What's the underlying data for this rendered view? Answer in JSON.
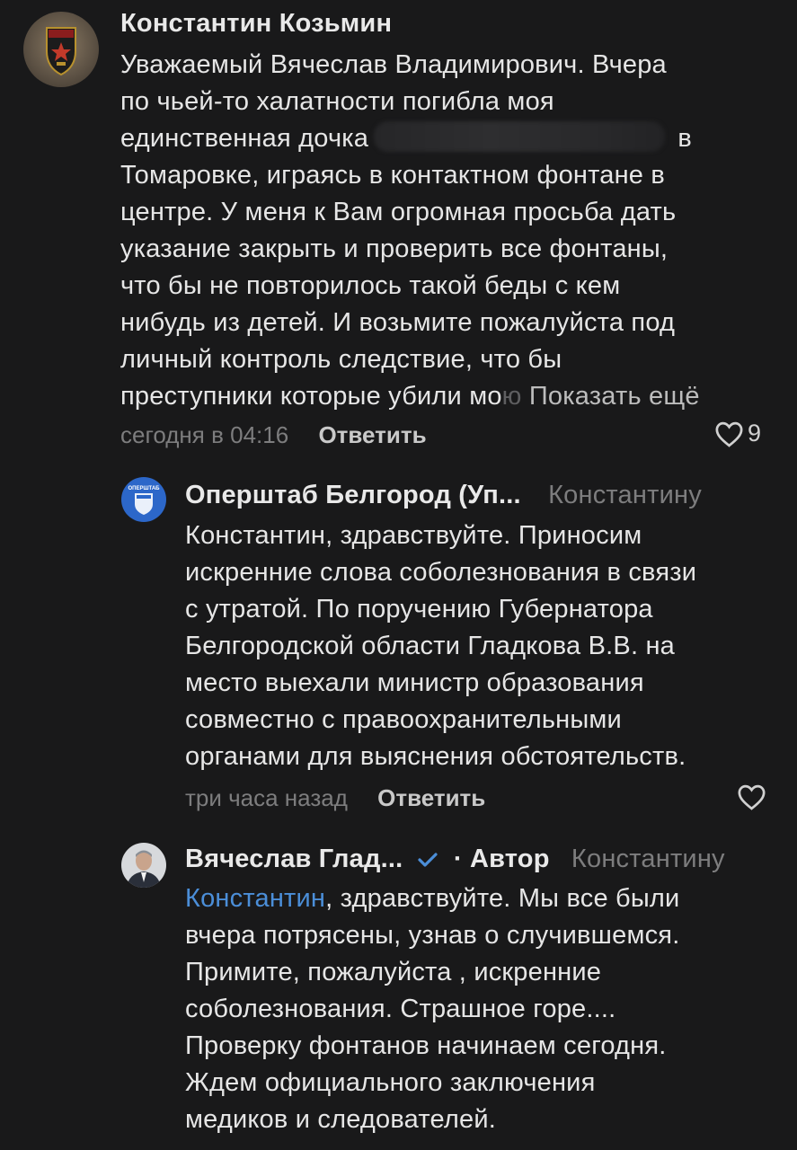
{
  "comments": [
    {
      "author": "Константин Козьмин",
      "text_lines": [
        "Уважаемый Вячеслав Владимирович. Вчера",
        "по чьей-то халатности погибла моя",
        "единственная дочка",
        "в",
        "Томаровке, играясь в контактном фонтане в",
        "центре. У меня к Вам огромная просьба дать",
        "указание закрыть и проверить все фонтаны,",
        "что бы не повторилось такой беды с кем",
        "нибудь из детей. И возьмите пожалуйста под",
        "личный контроль следствие, что бы",
        "преступники которые убили мо",
        "ю"
      ],
      "show_more": "Показать ещё",
      "time": "сегодня в 04:16",
      "reply_label": "Ответить",
      "likes": "9"
    },
    {
      "author": "Оперштаб Белгород (Уп...",
      "reply_to": "Константину",
      "text_lines": [
        "Константин, здравствуйте. Приносим",
        "искренние слова соболезнования в связи",
        "с утратой. По поручению Губернатора",
        "Белгородской области Гладкова В.В. на",
        "место выехали министр образования",
        "совместно с правоохранительными",
        "органами для выяснения обстоятельств."
      ],
      "time": "три часа назад",
      "reply_label": "Ответить",
      "avatar_text": "ОПЕРШТАБ"
    },
    {
      "author": "Вячеслав Глад...",
      "author_badge": "· Автор",
      "reply_to": "Константину",
      "mention": "Константин",
      "text_first_rest": ", здравствуйте. Мы все были",
      "text_lines": [
        "вчера потрясены, узнав о случившемся.",
        "Примите, пожалуйста , искренние",
        "соболезнования. Страшное горе....",
        "Проверку фонтанов начинаем сегодня.",
        "Ждем официального заключения",
        "медиков и следователей."
      ]
    }
  ],
  "icons": {
    "like": "heart-icon",
    "verified": "checkmark-icon"
  },
  "colors": {
    "background": "#19191a",
    "link": "#4b8ed8",
    "muted": "#7d7d7e"
  }
}
